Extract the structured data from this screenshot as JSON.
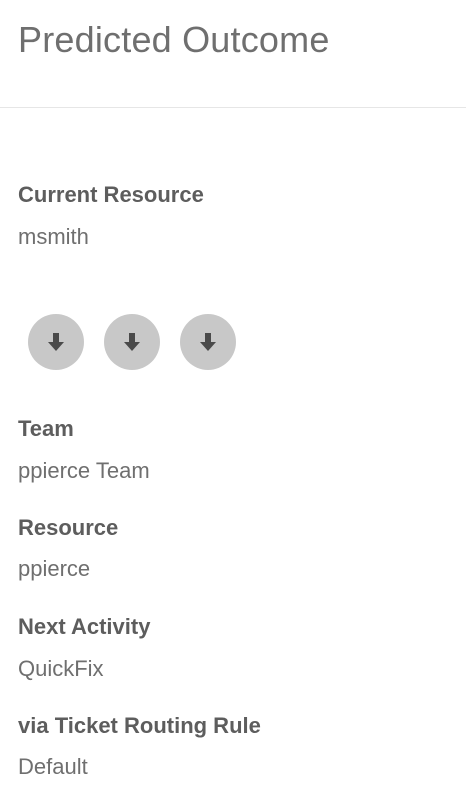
{
  "header": {
    "title": "Predicted Outcome"
  },
  "current_resource": {
    "label": "Current Resource",
    "value": "msmith"
  },
  "flow_icons": [
    {
      "icon": "arrow-down-icon"
    },
    {
      "icon": "arrow-down-icon"
    },
    {
      "icon": "arrow-down-icon"
    }
  ],
  "outcome": {
    "team_label": "Team",
    "team_value": "ppierce Team",
    "resource_label": "Resource",
    "resource_value": "ppierce",
    "next_activity_label": "Next Activity",
    "next_activity_value": "QuickFix",
    "rule_label": "via Ticket Routing Rule",
    "rule_value": "Default"
  },
  "colors": {
    "text_primary": "#5d5d5d",
    "text_secondary": "#6f6f6f",
    "divider": "#e6e6e6",
    "icon_circle": "#c8c8c8",
    "icon_arrow": "#4a4a4a"
  }
}
